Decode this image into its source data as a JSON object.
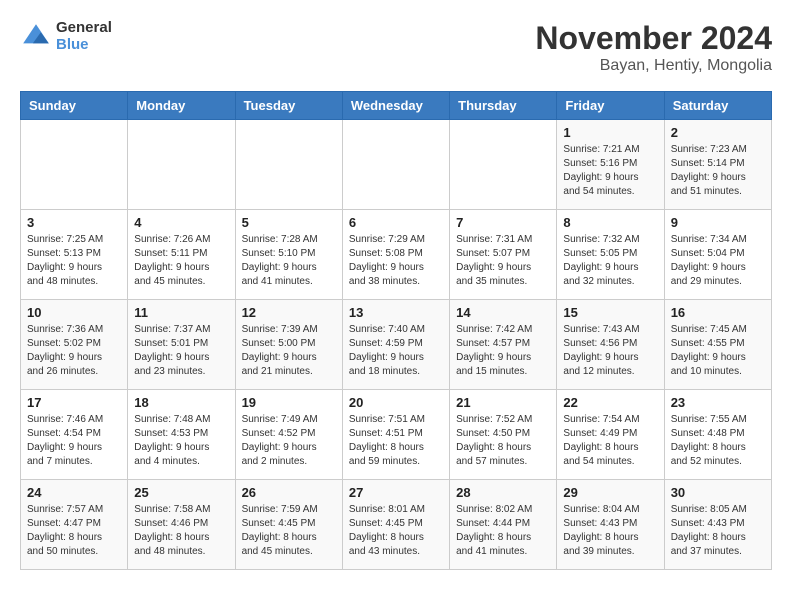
{
  "logo": {
    "general": "General",
    "blue": "Blue"
  },
  "title": "November 2024",
  "subtitle": "Bayan, Hentiy, Mongolia",
  "weekdays": [
    "Sunday",
    "Monday",
    "Tuesday",
    "Wednesday",
    "Thursday",
    "Friday",
    "Saturday"
  ],
  "weeks": [
    [
      {
        "day": "",
        "info": ""
      },
      {
        "day": "",
        "info": ""
      },
      {
        "day": "",
        "info": ""
      },
      {
        "day": "",
        "info": ""
      },
      {
        "day": "",
        "info": ""
      },
      {
        "day": "1",
        "info": "Sunrise: 7:21 AM\nSunset: 5:16 PM\nDaylight: 9 hours\nand 54 minutes."
      },
      {
        "day": "2",
        "info": "Sunrise: 7:23 AM\nSunset: 5:14 PM\nDaylight: 9 hours\nand 51 minutes."
      }
    ],
    [
      {
        "day": "3",
        "info": "Sunrise: 7:25 AM\nSunset: 5:13 PM\nDaylight: 9 hours\nand 48 minutes."
      },
      {
        "day": "4",
        "info": "Sunrise: 7:26 AM\nSunset: 5:11 PM\nDaylight: 9 hours\nand 45 minutes."
      },
      {
        "day": "5",
        "info": "Sunrise: 7:28 AM\nSunset: 5:10 PM\nDaylight: 9 hours\nand 41 minutes."
      },
      {
        "day": "6",
        "info": "Sunrise: 7:29 AM\nSunset: 5:08 PM\nDaylight: 9 hours\nand 38 minutes."
      },
      {
        "day": "7",
        "info": "Sunrise: 7:31 AM\nSunset: 5:07 PM\nDaylight: 9 hours\nand 35 minutes."
      },
      {
        "day": "8",
        "info": "Sunrise: 7:32 AM\nSunset: 5:05 PM\nDaylight: 9 hours\nand 32 minutes."
      },
      {
        "day": "9",
        "info": "Sunrise: 7:34 AM\nSunset: 5:04 PM\nDaylight: 9 hours\nand 29 minutes."
      }
    ],
    [
      {
        "day": "10",
        "info": "Sunrise: 7:36 AM\nSunset: 5:02 PM\nDaylight: 9 hours\nand 26 minutes."
      },
      {
        "day": "11",
        "info": "Sunrise: 7:37 AM\nSunset: 5:01 PM\nDaylight: 9 hours\nand 23 minutes."
      },
      {
        "day": "12",
        "info": "Sunrise: 7:39 AM\nSunset: 5:00 PM\nDaylight: 9 hours\nand 21 minutes."
      },
      {
        "day": "13",
        "info": "Sunrise: 7:40 AM\nSunset: 4:59 PM\nDaylight: 9 hours\nand 18 minutes."
      },
      {
        "day": "14",
        "info": "Sunrise: 7:42 AM\nSunset: 4:57 PM\nDaylight: 9 hours\nand 15 minutes."
      },
      {
        "day": "15",
        "info": "Sunrise: 7:43 AM\nSunset: 4:56 PM\nDaylight: 9 hours\nand 12 minutes."
      },
      {
        "day": "16",
        "info": "Sunrise: 7:45 AM\nSunset: 4:55 PM\nDaylight: 9 hours\nand 10 minutes."
      }
    ],
    [
      {
        "day": "17",
        "info": "Sunrise: 7:46 AM\nSunset: 4:54 PM\nDaylight: 9 hours\nand 7 minutes."
      },
      {
        "day": "18",
        "info": "Sunrise: 7:48 AM\nSunset: 4:53 PM\nDaylight: 9 hours\nand 4 minutes."
      },
      {
        "day": "19",
        "info": "Sunrise: 7:49 AM\nSunset: 4:52 PM\nDaylight: 9 hours\nand 2 minutes."
      },
      {
        "day": "20",
        "info": "Sunrise: 7:51 AM\nSunset: 4:51 PM\nDaylight: 8 hours\nand 59 minutes."
      },
      {
        "day": "21",
        "info": "Sunrise: 7:52 AM\nSunset: 4:50 PM\nDaylight: 8 hours\nand 57 minutes."
      },
      {
        "day": "22",
        "info": "Sunrise: 7:54 AM\nSunset: 4:49 PM\nDaylight: 8 hours\nand 54 minutes."
      },
      {
        "day": "23",
        "info": "Sunrise: 7:55 AM\nSunset: 4:48 PM\nDaylight: 8 hours\nand 52 minutes."
      }
    ],
    [
      {
        "day": "24",
        "info": "Sunrise: 7:57 AM\nSunset: 4:47 PM\nDaylight: 8 hours\nand 50 minutes."
      },
      {
        "day": "25",
        "info": "Sunrise: 7:58 AM\nSunset: 4:46 PM\nDaylight: 8 hours\nand 48 minutes."
      },
      {
        "day": "26",
        "info": "Sunrise: 7:59 AM\nSunset: 4:45 PM\nDaylight: 8 hours\nand 45 minutes."
      },
      {
        "day": "27",
        "info": "Sunrise: 8:01 AM\nSunset: 4:45 PM\nDaylight: 8 hours\nand 43 minutes."
      },
      {
        "day": "28",
        "info": "Sunrise: 8:02 AM\nSunset: 4:44 PM\nDaylight: 8 hours\nand 41 minutes."
      },
      {
        "day": "29",
        "info": "Sunrise: 8:04 AM\nSunset: 4:43 PM\nDaylight: 8 hours\nand 39 minutes."
      },
      {
        "day": "30",
        "info": "Sunrise: 8:05 AM\nSunset: 4:43 PM\nDaylight: 8 hours\nand 37 minutes."
      }
    ]
  ]
}
